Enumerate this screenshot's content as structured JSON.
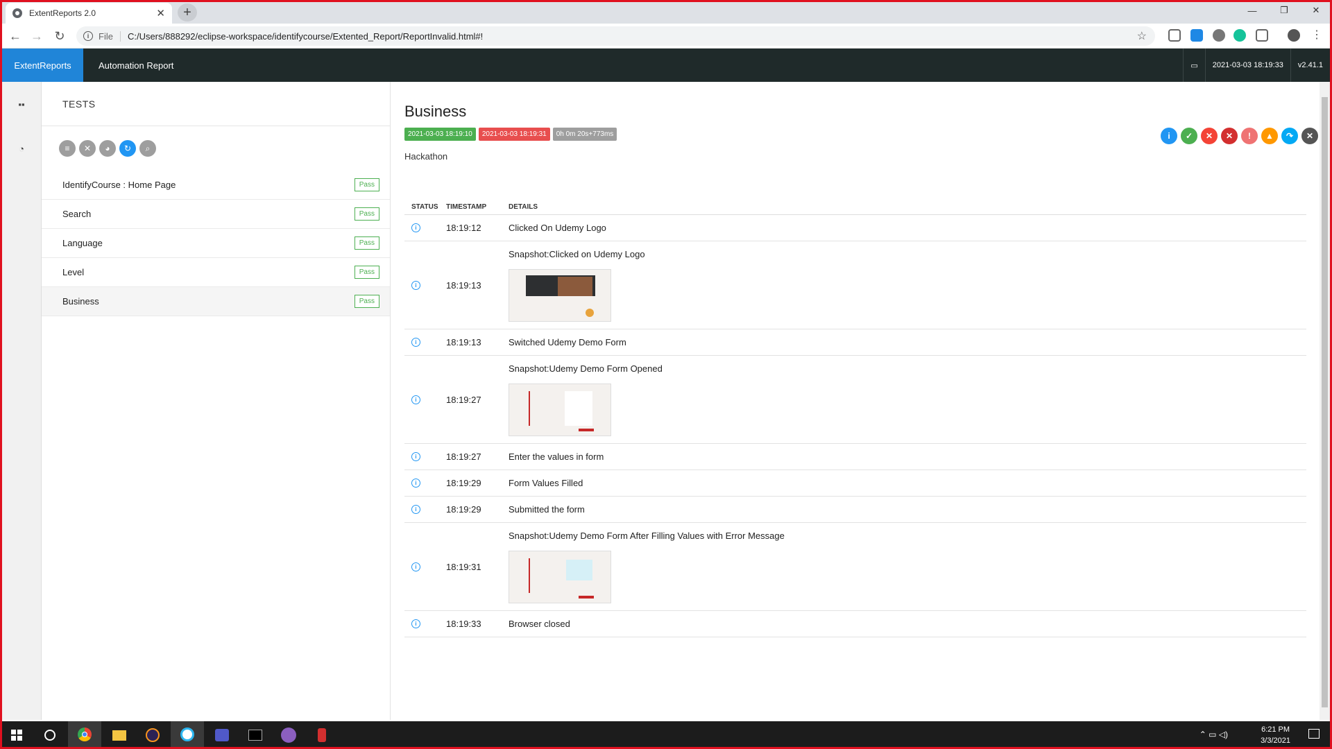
{
  "browser": {
    "tab_title": "ExtentReports 2.0",
    "file_label": "File",
    "url": "C:/Users/888292/eclipse-workspace/identifycourse/Extented_Report/ReportInvalid.html#!"
  },
  "header": {
    "brand": "ExtentReports",
    "report_name": "Automation Report",
    "datetime": "2021-03-03 18:19:33",
    "version": "v2.41.1"
  },
  "tests_panel": {
    "title": "TESTS",
    "tests": [
      {
        "name": "IdentifyCourse : Home Page",
        "status": "Pass"
      },
      {
        "name": "Search",
        "status": "Pass"
      },
      {
        "name": "Language",
        "status": "Pass"
      },
      {
        "name": "Level",
        "status": "Pass"
      },
      {
        "name": "Business",
        "status": "Pass"
      }
    ]
  },
  "detail": {
    "title": "Business",
    "start_time": "2021-03-03 18:19:10",
    "end_time": "2021-03-03 18:19:31",
    "duration": "0h 0m 20s+773ms",
    "category": "Hackathon",
    "columns": [
      "STATUS",
      "TIMESTAMP",
      "DETAILS"
    ],
    "logs": [
      {
        "time": "18:19:12",
        "details": "Clicked On Udemy Logo"
      },
      {
        "time": "18:19:13",
        "details": "Snapshot:Clicked on Udemy Logo"
      },
      {
        "time": "18:19:13",
        "details": "Switched Udemy Demo Form"
      },
      {
        "time": "18:19:27",
        "details": "Snapshot:Udemy Demo Form Opened"
      },
      {
        "time": "18:19:27",
        "details": "Enter the values in form"
      },
      {
        "time": "18:19:29",
        "details": "Form Values Filled"
      },
      {
        "time": "18:19:29",
        "details": "Submitted the form"
      },
      {
        "time": "18:19:31",
        "details": "Snapshot:Udemy Demo Form After Filling Values with Error Message"
      },
      {
        "time": "18:19:33",
        "details": "Browser closed"
      }
    ]
  },
  "taskbar": {
    "time": "6:21 PM",
    "date": "3/3/2021"
  },
  "colors": {
    "brand_blue": "#2085d8",
    "header_dark": "#1f2a2a",
    "pass_green": "#4caf50",
    "fail_red": "#e84e4e"
  }
}
